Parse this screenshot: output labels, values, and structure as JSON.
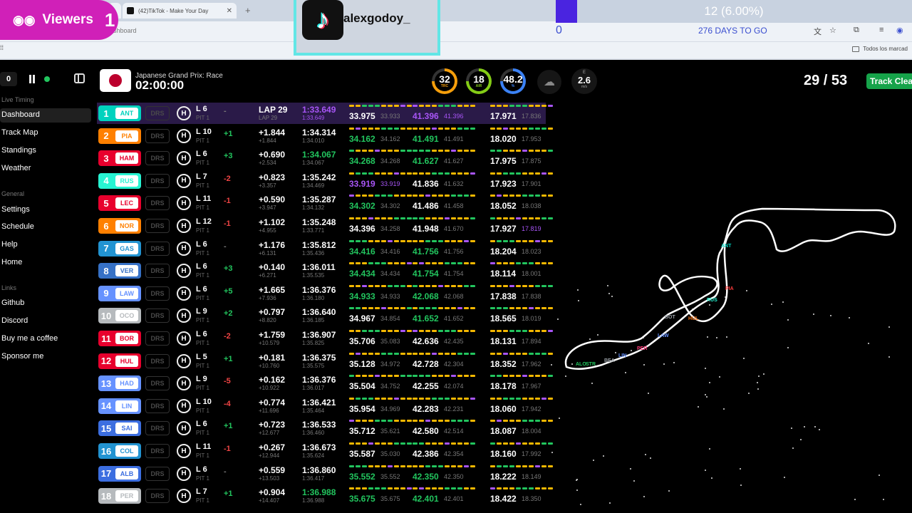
{
  "browser": {
    "tab_title": "(42)TikTok - Make Your Day",
    "tab_close": "✕",
    "new_tab": "+",
    "url_fragment": "ashboard",
    "bookmarks_all": "Todos los marcad",
    "profile_icon": "profile-icon"
  },
  "overlay": {
    "viewers_label": "Viewers",
    "viewers_count": "1",
    "tiktok_user": "alexgodoy_",
    "goal_progress_text": "12 (6.00%)",
    "goal_progress": 0.06,
    "goal_start": "0",
    "goal_days": "276 DAYS TO GO",
    "colors": {
      "viewers_bg": "#d020b8",
      "goal_fill": "#4a24e0",
      "tiktok_border": "#62e6e6"
    }
  },
  "app": {
    "counter": "0",
    "race_name": "Japanese Grand Prix: Race",
    "race_clock": "02:00:00",
    "gauges": [
      {
        "value": "32",
        "label": "TRC",
        "color": "#f59e0b"
      },
      {
        "value": "18",
        "label": "AIR",
        "color": "#84cc16"
      },
      {
        "value": "48.2",
        "label": "%",
        "color": "#3b82f6"
      }
    ],
    "weather_icon": "rain-cloud-icon",
    "wind": {
      "direction": "E",
      "value": "2.6",
      "unit": "m/s"
    },
    "lap_count": "29 / 53",
    "track_status": "Track Clear",
    "colors": {
      "live": "#22c55e",
      "track_status": "#16a34a",
      "personal_best": "#22c55e",
      "fastest": "#a855f7"
    }
  },
  "sidebar": {
    "sections": [
      {
        "title": "Live Timing",
        "items": [
          "Dashboard",
          "Track Map",
          "Standings",
          "Weather"
        ]
      },
      {
        "title": "General",
        "items": [
          "Settings",
          "Schedule",
          "Help",
          "Home"
        ]
      },
      {
        "title": "Links",
        "items": [
          "Github",
          "Discord",
          "Buy me a coffee",
          "Sponsor me"
        ]
      }
    ],
    "active": "Dashboard"
  },
  "drivers": [
    {
      "pos": "1",
      "code": "ANT",
      "color": "#00d2be",
      "drs": "DRS",
      "tyre": "H",
      "laps": "L 6",
      "pit": "PIT 1",
      "chg": "-",
      "chgc": "grey",
      "gap": "LAP 29",
      "gap2": "LAP 29",
      "lt": "1:33.649",
      "ltc": "purple",
      "lt2": "1:33.649",
      "s1": "33.975",
      "s1c": "white",
      "s1p": "33.933",
      "s2": "41.396",
      "s2c": "purple",
      "s2p": "41.396",
      "s3": "17.971",
      "s3c": "white",
      "s3p": "17.836"
    },
    {
      "pos": "2",
      "code": "PIA",
      "color": "#ff8000",
      "drs": "DRS",
      "tyre": "H",
      "laps": "L 10",
      "pit": "PIT 1",
      "chg": "+1",
      "chgc": "green",
      "gap": "+1.844",
      "gap2": "+1.844",
      "lt": "1:34.314",
      "ltc": "white",
      "lt2": "1:34.010",
      "s1": "34.162",
      "s1c": "green",
      "s1p": "34.162",
      "s2": "41.491",
      "s2c": "green",
      "s2p": "41.491",
      "s3": "18.020",
      "s3c": "white",
      "s3p": "17.953"
    },
    {
      "pos": "3",
      "code": "HAM",
      "color": "#e8002d",
      "drs": "DRS",
      "tyre": "H",
      "laps": "L 6",
      "pit": "PIT 1",
      "chg": "+3",
      "chgc": "green",
      "gap": "+0.690",
      "gap2": "+2.534",
      "lt": "1:34.067",
      "ltc": "green",
      "lt2": "1:34.067",
      "s1": "34.268",
      "s1c": "green",
      "s1p": "34.268",
      "s2": "41.627",
      "s2c": "green",
      "s2p": "41.627",
      "s3": "17.975",
      "s3c": "white",
      "s3p": "17.875"
    },
    {
      "pos": "4",
      "code": "RUS",
      "color": "#27f4d2",
      "drs": "DRS",
      "tyre": "H",
      "laps": "L 7",
      "pit": "PIT 1",
      "chg": "-2",
      "chgc": "red",
      "gap": "+0.823",
      "gap2": "+3.357",
      "lt": "1:35.242",
      "ltc": "white",
      "lt2": "1:34.469",
      "s1": "33.919",
      "s1c": "purple",
      "s1p": "33.919",
      "s2": "41.836",
      "s2c": "white",
      "s2p": "41.632",
      "s3": "17.923",
      "s3c": "white",
      "s3p": "17.901"
    },
    {
      "pos": "5",
      "code": "LEC",
      "color": "#e8002d",
      "drs": "DRS",
      "tyre": "H",
      "laps": "L 11",
      "pit": "PIT 1",
      "chg": "-1",
      "chgc": "red",
      "gap": "+0.590",
      "gap2": "+3.947",
      "lt": "1:35.287",
      "ltc": "white",
      "lt2": "1:34.132",
      "s1": "34.302",
      "s1c": "green",
      "s1p": "34.302",
      "s2": "41.486",
      "s2c": "white",
      "s2p": "41.458",
      "s3": "18.052",
      "s3c": "white",
      "s3p": "18.038"
    },
    {
      "pos": "6",
      "code": "NOR",
      "color": "#ff8000",
      "drs": "DRS",
      "tyre": "H",
      "laps": "L 12",
      "pit": "PIT 1",
      "chg": "-1",
      "chgc": "red",
      "gap": "+1.102",
      "gap2": "+4.955",
      "lt": "1:35.248",
      "ltc": "white",
      "lt2": "1:33.771",
      "s1": "34.396",
      "s1c": "white",
      "s1p": "34.258",
      "s2": "41.948",
      "s2c": "white",
      "s2p": "41.670",
      "s3": "17.927",
      "s3c": "white",
      "s3p": "17.819"
    },
    {
      "pos": "7",
      "code": "GAS",
      "color": "#2293d1",
      "drs": "DRS",
      "tyre": "H",
      "laps": "L 6",
      "pit": "PIT 1",
      "chg": "-",
      "chgc": "grey",
      "gap": "+1.176",
      "gap2": "+6.131",
      "lt": "1:35.812",
      "ltc": "white",
      "lt2": "1:35.436",
      "s1": "34.416",
      "s1c": "green",
      "s1p": "34.416",
      "s2": "41.756",
      "s2c": "green",
      "s2p": "41.756",
      "s3": "18.204",
      "s3c": "white",
      "s3p": "18.023"
    },
    {
      "pos": "8",
      "code": "VER",
      "color": "#3671c6",
      "drs": "DRS",
      "tyre": "H",
      "laps": "L 6",
      "pit": "PIT 1",
      "chg": "+3",
      "chgc": "green",
      "gap": "+0.140",
      "gap2": "+6.271",
      "lt": "1:36.011",
      "ltc": "white",
      "lt2": "1:35.535",
      "s1": "34.434",
      "s1c": "green",
      "s1p": "34.434",
      "s2": "41.754",
      "s2c": "green",
      "s2p": "41.754",
      "s3": "18.114",
      "s3c": "white",
      "s3p": "18.001"
    },
    {
      "pos": "9",
      "code": "LAW",
      "color": "#6692ff",
      "drs": "DRS",
      "tyre": "H",
      "laps": "L 6",
      "pit": "PIT 1",
      "chg": "+5",
      "chgc": "green",
      "gap": "+1.665",
      "gap2": "+7.936",
      "lt": "1:36.376",
      "ltc": "white",
      "lt2": "1:36.180",
      "s1": "34.933",
      "s1c": "green",
      "s1p": "34.933",
      "s2": "42.068",
      "s2c": "green",
      "s2p": "42.068",
      "s3": "17.838",
      "s3c": "white",
      "s3p": "17.838"
    },
    {
      "pos": "10",
      "code": "OCO",
      "color": "#b6babd",
      "drs": "DRS",
      "tyre": "H",
      "laps": "L 9",
      "pit": "PIT 1",
      "chg": "+2",
      "chgc": "green",
      "gap": "+0.797",
      "gap2": "+8.820",
      "lt": "1:36.640",
      "ltc": "white",
      "lt2": "1:36.185",
      "s1": "34.967",
      "s1c": "white",
      "s1p": "34.854",
      "s2": "41.652",
      "s2c": "green",
      "s2p": "41.652",
      "s3": "18.565",
      "s3c": "white",
      "s3p": "18.019"
    },
    {
      "pos": "11",
      "code": "BOR",
      "color": "#e8002d",
      "drs": "DRS",
      "tyre": "H",
      "laps": "L 6",
      "pit": "PIT 1",
      "chg": "-2",
      "chgc": "red",
      "gap": "+1.759",
      "gap2": "+10.579",
      "lt": "1:36.907",
      "ltc": "white",
      "lt2": "1:35.825",
      "s1": "35.706",
      "s1c": "white",
      "s1p": "35.083",
      "s2": "42.636",
      "s2c": "white",
      "s2p": "42.435",
      "s3": "18.131",
      "s3c": "white",
      "s3p": "17.894"
    },
    {
      "pos": "12",
      "code": "HUL",
      "color": "#e8002d",
      "drs": "DRS",
      "tyre": "H",
      "laps": "L 5",
      "pit": "PIT 1",
      "chg": "+1",
      "chgc": "green",
      "gap": "+0.181",
      "gap2": "+10.760",
      "lt": "1:36.375",
      "ltc": "white",
      "lt2": "1:35.575",
      "s1": "35.128",
      "s1c": "white",
      "s1p": "34.972",
      "s2": "42.728",
      "s2c": "white",
      "s2p": "42.304",
      "s3": "18.352",
      "s3c": "white",
      "s3p": "17.962"
    },
    {
      "pos": "13",
      "code": "HAD",
      "color": "#6692ff",
      "drs": "DRS",
      "tyre": "H",
      "laps": "L 9",
      "pit": "PIT 1",
      "chg": "-5",
      "chgc": "red",
      "gap": "+0.162",
      "gap2": "+10.922",
      "lt": "1:36.376",
      "ltc": "white",
      "lt2": "1:36.017",
      "s1": "35.504",
      "s1c": "white",
      "s1p": "34.752",
      "s2": "42.255",
      "s2c": "white",
      "s2p": "42.074",
      "s3": "18.178",
      "s3c": "white",
      "s3p": "17.967"
    },
    {
      "pos": "14",
      "code": "LIN",
      "color": "#6692ff",
      "drs": "DRS",
      "tyre": "H",
      "laps": "L 10",
      "pit": "PIT 1",
      "chg": "-4",
      "chgc": "red",
      "gap": "+0.774",
      "gap2": "+11.696",
      "lt": "1:36.421",
      "ltc": "white",
      "lt2": "1:35.464",
      "s1": "35.954",
      "s1c": "white",
      "s1p": "34.969",
      "s2": "42.283",
      "s2c": "white",
      "s2p": "42.231",
      "s3": "18.060",
      "s3c": "white",
      "s3p": "17.942"
    },
    {
      "pos": "15",
      "code": "SAI",
      "color": "#3c6ee0",
      "drs": "DRS",
      "tyre": "H",
      "laps": "L 6",
      "pit": "PIT 1",
      "chg": "+1",
      "chgc": "green",
      "gap": "+0.723",
      "gap2": "+12.677",
      "lt": "1:36.533",
      "ltc": "white",
      "lt2": "1:36.460",
      "s1": "35.712",
      "s1c": "white",
      "s1p": "35.621",
      "s2": "42.580",
      "s2c": "white",
      "s2p": "42.514",
      "s3": "18.087",
      "s3c": "white",
      "s3p": "18.004"
    },
    {
      "pos": "16",
      "code": "COL",
      "color": "#2293d1",
      "drs": "DRS",
      "tyre": "H",
      "laps": "L 11",
      "pit": "PIT 1",
      "chg": "-1",
      "chgc": "red",
      "gap": "+0.267",
      "gap2": "+12.944",
      "lt": "1:36.673",
      "ltc": "white",
      "lt2": "1:35.624",
      "s1": "35.587",
      "s1c": "white",
      "s1p": "35.030",
      "s2": "42.386",
      "s2c": "white",
      "s2p": "42.354",
      "s3": "18.160",
      "s3c": "white",
      "s3p": "17.992"
    },
    {
      "pos": "17",
      "code": "ALB",
      "color": "#3c6ee0",
      "drs": "DRS",
      "tyre": "H",
      "laps": "L 6",
      "pit": "PIT 1",
      "chg": "-",
      "chgc": "grey",
      "gap": "+0.559",
      "gap2": "+13.503",
      "lt": "1:36.860",
      "ltc": "white",
      "lt2": "1:36.417",
      "s1": "35.552",
      "s1c": "green",
      "s1p": "35.552",
      "s2": "42.350",
      "s2c": "green",
      "s2p": "42.350",
      "s3": "18.222",
      "s3c": "white",
      "s3p": "18.149"
    },
    {
      "pos": "18",
      "code": "PER",
      "color": "#b6babd",
      "drs": "DRS",
      "tyre": "H",
      "laps": "L 7",
      "pit": "PIT 1",
      "chg": "+1",
      "chgc": "green",
      "gap": "+0.904",
      "gap2": "+14.407",
      "lt": "1:36.988",
      "ltc": "green",
      "lt2": "1:36.988",
      "s1": "35.675",
      "s1c": "green",
      "s1p": "35.675",
      "s2": "42.401",
      "s2c": "green",
      "s2p": "42.401",
      "s3": "18.422",
      "s3c": "white",
      "s3p": "18.350"
    }
  ],
  "track_map": {
    "labels": [
      {
        "code": "ANT",
        "color": "#00d2be"
      },
      {
        "code": "PIA",
        "color": "#ff3b3b"
      },
      {
        "code": "RUS",
        "color": "#27f4d2"
      },
      {
        "code": "BOT",
        "color": "#9aa0a6"
      },
      {
        "code": "HUL",
        "color": "#f97316"
      },
      {
        "code": "LAW",
        "color": "#6692ff"
      },
      {
        "code": "LIN",
        "color": "#6692ff"
      },
      {
        "code": "PER",
        "color": "#ff3b7a"
      },
      {
        "code": "ALO",
        "color": "#22c55e"
      },
      {
        "code": "STR",
        "color": "#22c55e"
      },
      {
        "code": "BEA",
        "color": "#9aa0a6"
      }
    ]
  }
}
